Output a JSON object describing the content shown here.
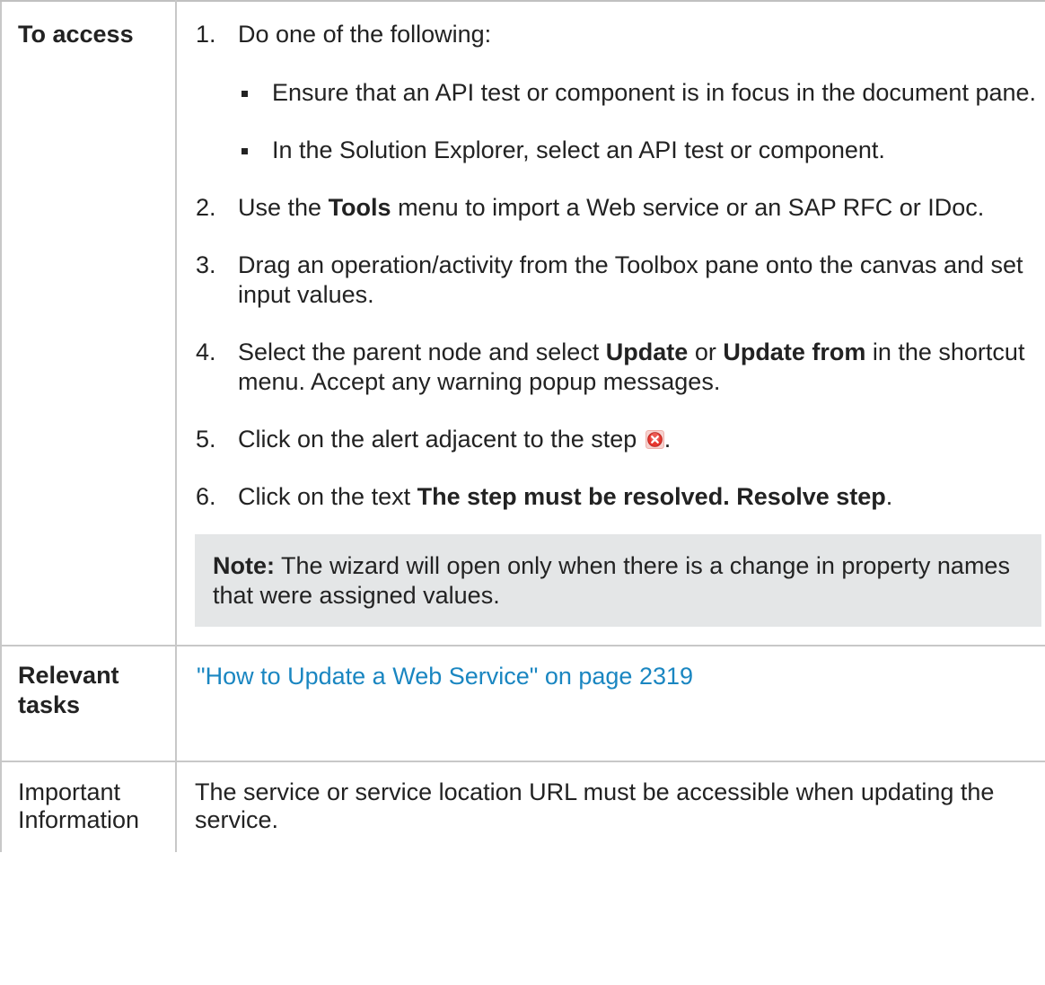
{
  "rows": {
    "access": {
      "label": "To access",
      "steps": [
        {
          "num": "1.",
          "text": "Do one of the following:"
        },
        {
          "num": "2.",
          "pre": "Use the ",
          "bold": "Tools",
          "post": " menu to import a Web service or an SAP RFC or IDoc."
        },
        {
          "num": "3.",
          "text": "Drag an operation/activity from the Toolbox pane onto the canvas and set input values."
        },
        {
          "num": "4.",
          "pre": "Select the parent node and select ",
          "bold1": "Update",
          "mid": " or ",
          "bold2": "Update from",
          "post": " in the shortcut menu. Accept any warning popup messages."
        },
        {
          "num": "5.",
          "text": "Click on the alert adjacent to the step",
          "post": "."
        },
        {
          "num": "6.",
          "pre": "Click on the text ",
          "bold": "The step must be resolved. Resolve step",
          "post": "."
        }
      ],
      "bullets": [
        "Ensure that an API test or component is in focus in the document pane.",
        "In the Solution Explorer, select an API test or component."
      ],
      "note": {
        "label": "Note:",
        "text": " The wizard will open only when there is a change in property names that were assigned values."
      }
    },
    "tasks": {
      "label": "Relevant tasks",
      "link": "\"How to Update a Web Service\" on page 2319"
    },
    "info": {
      "label": "Important Information",
      "text": "The service or service location URL must be accessible when updating the service."
    }
  },
  "icons": {
    "alert": "error-alert-icon",
    "alert_color": "#e8372f",
    "link_color": "#1a86c1",
    "note_bg": "#e4e6e7",
    "border_color": "#c8c8c8"
  }
}
